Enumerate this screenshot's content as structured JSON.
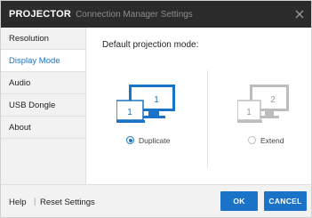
{
  "window": {
    "app_name": "PROJECTOR",
    "title": "Connection Manager Settings",
    "close_icon": "close-icon"
  },
  "sidebar": {
    "items": [
      {
        "label": "Resolution",
        "active": false
      },
      {
        "label": "Display Mode",
        "active": true
      },
      {
        "label": "Audio",
        "active": false
      },
      {
        "label": "USB Dongle",
        "active": false
      },
      {
        "label": "About",
        "active": false
      }
    ]
  },
  "main": {
    "title": "Default projection mode:",
    "options": [
      {
        "label": "Duplicate",
        "selected": true,
        "screen_1": "1",
        "screen_2": "1",
        "icon": "duplicate-display-icon"
      },
      {
        "label": "Extend",
        "selected": false,
        "screen_1": "1",
        "screen_2": "2",
        "icon": "extend-display-icon"
      }
    ]
  },
  "footer": {
    "help": "Help",
    "separator": "|",
    "reset": "Reset Settings",
    "ok": "OK",
    "cancel": "CANCEL"
  },
  "colors": {
    "titlebar": "#2b2b2b",
    "accent": "#1a73c6",
    "sidebar_bg": "#f2f2f2",
    "inactive_icon": "#bdbdbd"
  }
}
